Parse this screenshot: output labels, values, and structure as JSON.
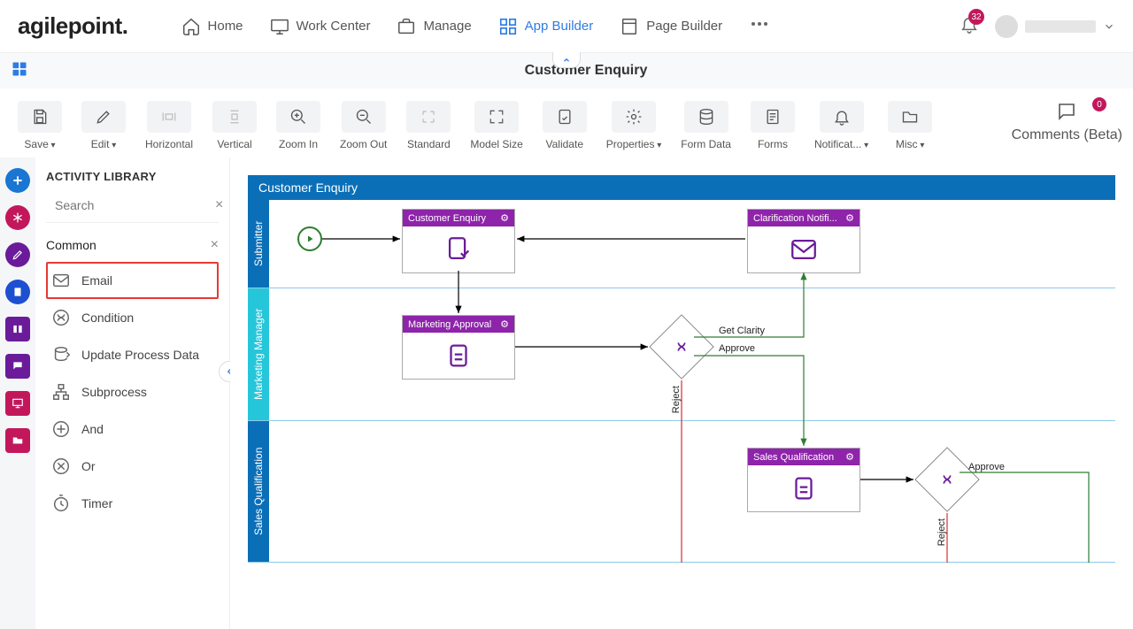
{
  "brand": "agilepoint",
  "notifications_count": "32",
  "comments_count": "0",
  "nav": {
    "home": "Home",
    "work_center": "Work Center",
    "manage": "Manage",
    "app_builder": "App Builder",
    "page_builder": "Page Builder"
  },
  "page_title": "Customer Enquiry",
  "toolbar": {
    "save": "Save",
    "edit": "Edit",
    "horizontal": "Horizontal",
    "vertical": "Vertical",
    "zoom_in": "Zoom In",
    "zoom_out": "Zoom Out",
    "standard": "Standard",
    "model_size": "Model Size",
    "validate": "Validate",
    "properties": "Properties",
    "form_data": "Form Data",
    "forms": "Forms",
    "notification": "Notificat...",
    "misc": "Misc",
    "comments": "Comments (Beta)"
  },
  "library": {
    "title": "ACTIVITY LIBRARY",
    "search_placeholder": "Search",
    "section": "Common",
    "items": {
      "email": "Email",
      "condition": "Condition",
      "update_process_data": "Update Process Data",
      "subprocess": "Subprocess",
      "and": "And",
      "or": "Or",
      "timer": "Timer"
    }
  },
  "workflow": {
    "title": "Customer Enquiry",
    "lanes": {
      "submitter": "Submitter",
      "marketing_manager": "Marketing Manager",
      "sales_qualification": "Sales Qualification"
    },
    "nodes": {
      "customer_enquiry": "Customer Enquiry",
      "clarification_notif": "Clarification Notifi...",
      "marketing_approval": "Marketing Approval",
      "sales_qualification": "Sales Qualification"
    },
    "edge_labels": {
      "get_clarity": "Get Clarity",
      "approve": "Approve",
      "reject": "Reject"
    }
  }
}
